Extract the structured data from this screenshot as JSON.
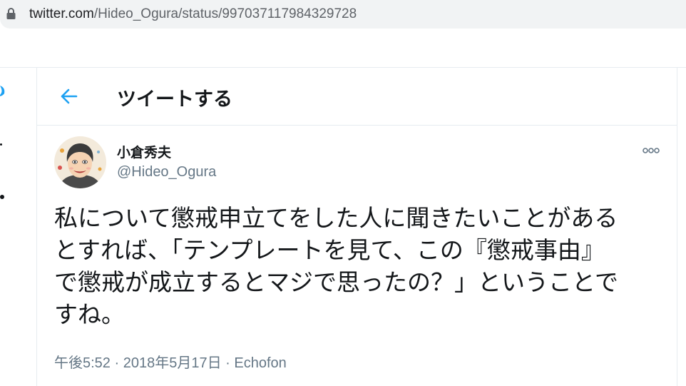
{
  "browser": {
    "url_host": "twitter.com",
    "url_path": "/Hideo_Ogura/status/997037117984329728",
    "icon": "lock-icon"
  },
  "header": {
    "back_icon": "arrow-left-icon",
    "title": "ツイートする"
  },
  "tweet": {
    "display_name": "小倉秀夫",
    "handle": "@Hideo_Ogura",
    "text": "私について懲戒申立てをした人に聞きたいことがある\nとすれば、「テンプレートを見て、この『懲戒事由』\nで懲戒が成立するとマジで思ったの？」ということで\nすね。",
    "time": "午後5:52",
    "date": "2018年5月17日",
    "source": "Echofon",
    "separator": " · "
  },
  "colors": {
    "accent": "#1da1f2",
    "text": "#14171a",
    "secondary": "#657786",
    "border": "#e6ecf0",
    "urlbar": "#f1f3f4"
  }
}
